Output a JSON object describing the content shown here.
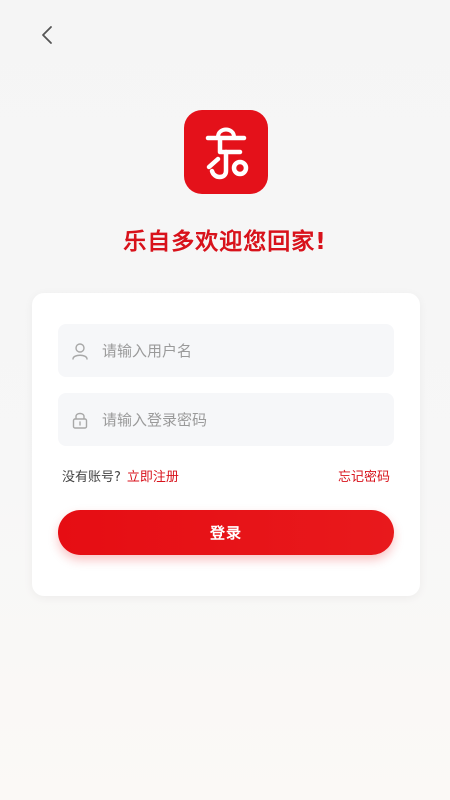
{
  "header": {
    "back_icon": "chevron-left-icon"
  },
  "brand": {
    "logo_icon": "le-shopping-bag-logo-icon",
    "logo_color": "#e4111a",
    "welcome_text": "乐自多欢迎您回家!"
  },
  "form": {
    "username_placeholder": "请输入用户名",
    "username_value": "",
    "username_icon": "user-icon",
    "password_placeholder": "请输入登录密码",
    "password_value": "",
    "password_icon": "lock-icon",
    "no_account_text": "没有账号?",
    "register_label": "立即注册",
    "forgot_label": "忘记密码",
    "login_label": "登录"
  },
  "colors": {
    "accent": "#d8121b",
    "button": "#e60d13"
  }
}
